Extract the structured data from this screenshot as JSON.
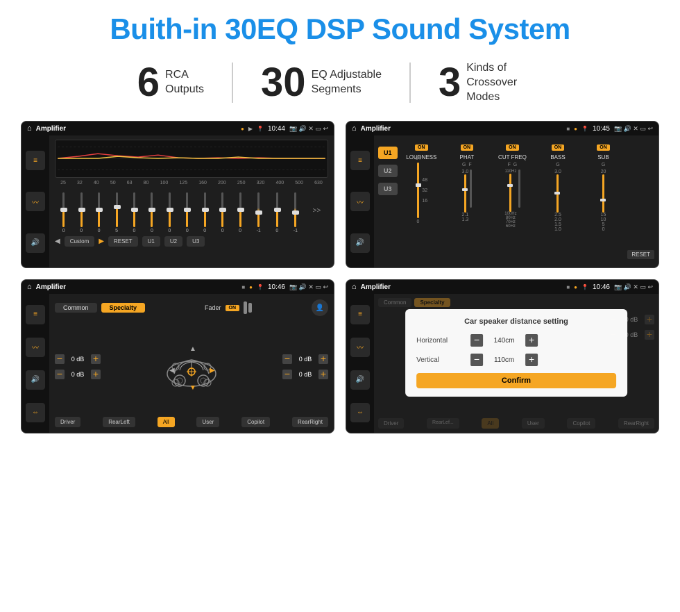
{
  "page": {
    "title": "Buith-in 30EQ DSP Sound System"
  },
  "stats": [
    {
      "id": "rca",
      "number": "6",
      "label": "RCA\nOutputs"
    },
    {
      "id": "eq",
      "number": "30",
      "label": "EQ Adjustable\nSegments"
    },
    {
      "id": "crossover",
      "number": "3",
      "label": "Kinds of\nCrossover Modes"
    }
  ],
  "screens": {
    "s1": {
      "status": {
        "app": "Amplifier",
        "time": "10:44"
      },
      "freqs": [
        "25",
        "32",
        "40",
        "50",
        "63",
        "80",
        "100",
        "125",
        "160",
        "200",
        "250",
        "320",
        "400",
        "500",
        "630"
      ],
      "sliders": [
        {
          "val": "0",
          "pos": 50
        },
        {
          "val": "0",
          "pos": 50
        },
        {
          "val": "0",
          "pos": 50
        },
        {
          "val": "5",
          "pos": 55
        },
        {
          "val": "0",
          "pos": 50
        },
        {
          "val": "0",
          "pos": 50
        },
        {
          "val": "0",
          "pos": 50
        },
        {
          "val": "0",
          "pos": 50
        },
        {
          "val": "0",
          "pos": 50
        },
        {
          "val": "0",
          "pos": 50
        },
        {
          "val": "0",
          "pos": 50
        },
        {
          "val": "-1",
          "pos": 45
        },
        {
          "val": "0",
          "pos": 50
        },
        {
          "val": "-1",
          "pos": 45
        }
      ],
      "buttons": [
        "Custom",
        "RESET",
        "U1",
        "U2",
        "U3"
      ]
    },
    "s2": {
      "status": {
        "app": "Amplifier",
        "time": "10:45"
      },
      "u_buttons": [
        "U1",
        "U2",
        "U3"
      ],
      "channels": [
        "LOUDNESS",
        "PHAT",
        "CUT FREQ",
        "BASS",
        "SUB"
      ]
    },
    "s3": {
      "status": {
        "app": "Amplifier",
        "time": "10:46"
      },
      "tabs": [
        "Common",
        "Specialty"
      ],
      "fader_label": "Fader",
      "fader_on": "ON",
      "volumes": [
        "0 dB",
        "0 dB",
        "0 dB",
        "0 dB"
      ],
      "bottom_btns": [
        "Driver",
        "RearLeft",
        "All",
        "User",
        "Copilot",
        "RearRight"
      ]
    },
    "s4": {
      "status": {
        "app": "Amplifier",
        "time": "10:46"
      },
      "tabs": [
        "Common",
        "Specialty"
      ],
      "dialog": {
        "title": "Car speaker distance setting",
        "horizontal_label": "Horizontal",
        "horizontal_value": "140cm",
        "vertical_label": "Vertical",
        "vertical_value": "110cm",
        "confirm_label": "Confirm"
      },
      "right_volumes": [
        "0 dB",
        "0 dB"
      ],
      "bottom_btns": [
        "Driver",
        "RearLeft",
        "All",
        "User",
        "Copilot",
        "RearRight"
      ]
    }
  }
}
